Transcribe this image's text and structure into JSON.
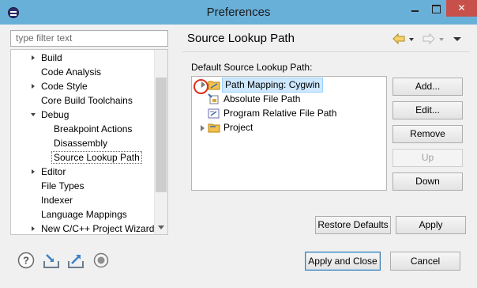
{
  "window": {
    "title": "Preferences"
  },
  "filter": {
    "placeholder": "type filter text"
  },
  "nav": {
    "items": [
      {
        "label": "Build",
        "expander": "closed"
      },
      {
        "label": "Code Analysis",
        "expander": "none"
      },
      {
        "label": "Code Style",
        "expander": "closed"
      },
      {
        "label": "Core Build Toolchains",
        "expander": "none"
      },
      {
        "label": "Debug",
        "expander": "open"
      },
      {
        "label": "Breakpoint Actions",
        "expander": "none"
      },
      {
        "label": "Disassembly",
        "expander": "none"
      },
      {
        "label": "Source Lookup Path",
        "expander": "none",
        "selected": true
      },
      {
        "label": "Editor",
        "expander": "closed"
      },
      {
        "label": "File Types",
        "expander": "none"
      },
      {
        "label": "Indexer",
        "expander": "none"
      },
      {
        "label": "Language Mappings",
        "expander": "none"
      },
      {
        "label": "New C/C++ Project Wizard",
        "expander": "closed"
      }
    ]
  },
  "page": {
    "title": "Source Lookup Path",
    "group_label": "Default Source Lookup Path:",
    "sources": [
      {
        "label": "Path Mapping: Cygwin",
        "icon": "path-mapping-icon",
        "selected": true
      },
      {
        "label": "Absolute File Path",
        "icon": "absolute-path-icon"
      },
      {
        "label": "Program Relative File Path",
        "icon": "program-relative-icon"
      },
      {
        "label": "Project",
        "icon": "folder-icon"
      }
    ],
    "side_buttons": {
      "add": "Add...",
      "edit": "Edit...",
      "remove": "Remove",
      "up": "Up",
      "down": "Down"
    },
    "restore_defaults": "Restore Defaults",
    "apply": "Apply"
  },
  "footer": {
    "apply_close": "Apply and Close",
    "cancel": "Cancel"
  },
  "colors": {
    "titlebar": "#69b0d9",
    "close": "#c7504a",
    "selection": "#cde8ff",
    "annotation": "#e0301e"
  }
}
